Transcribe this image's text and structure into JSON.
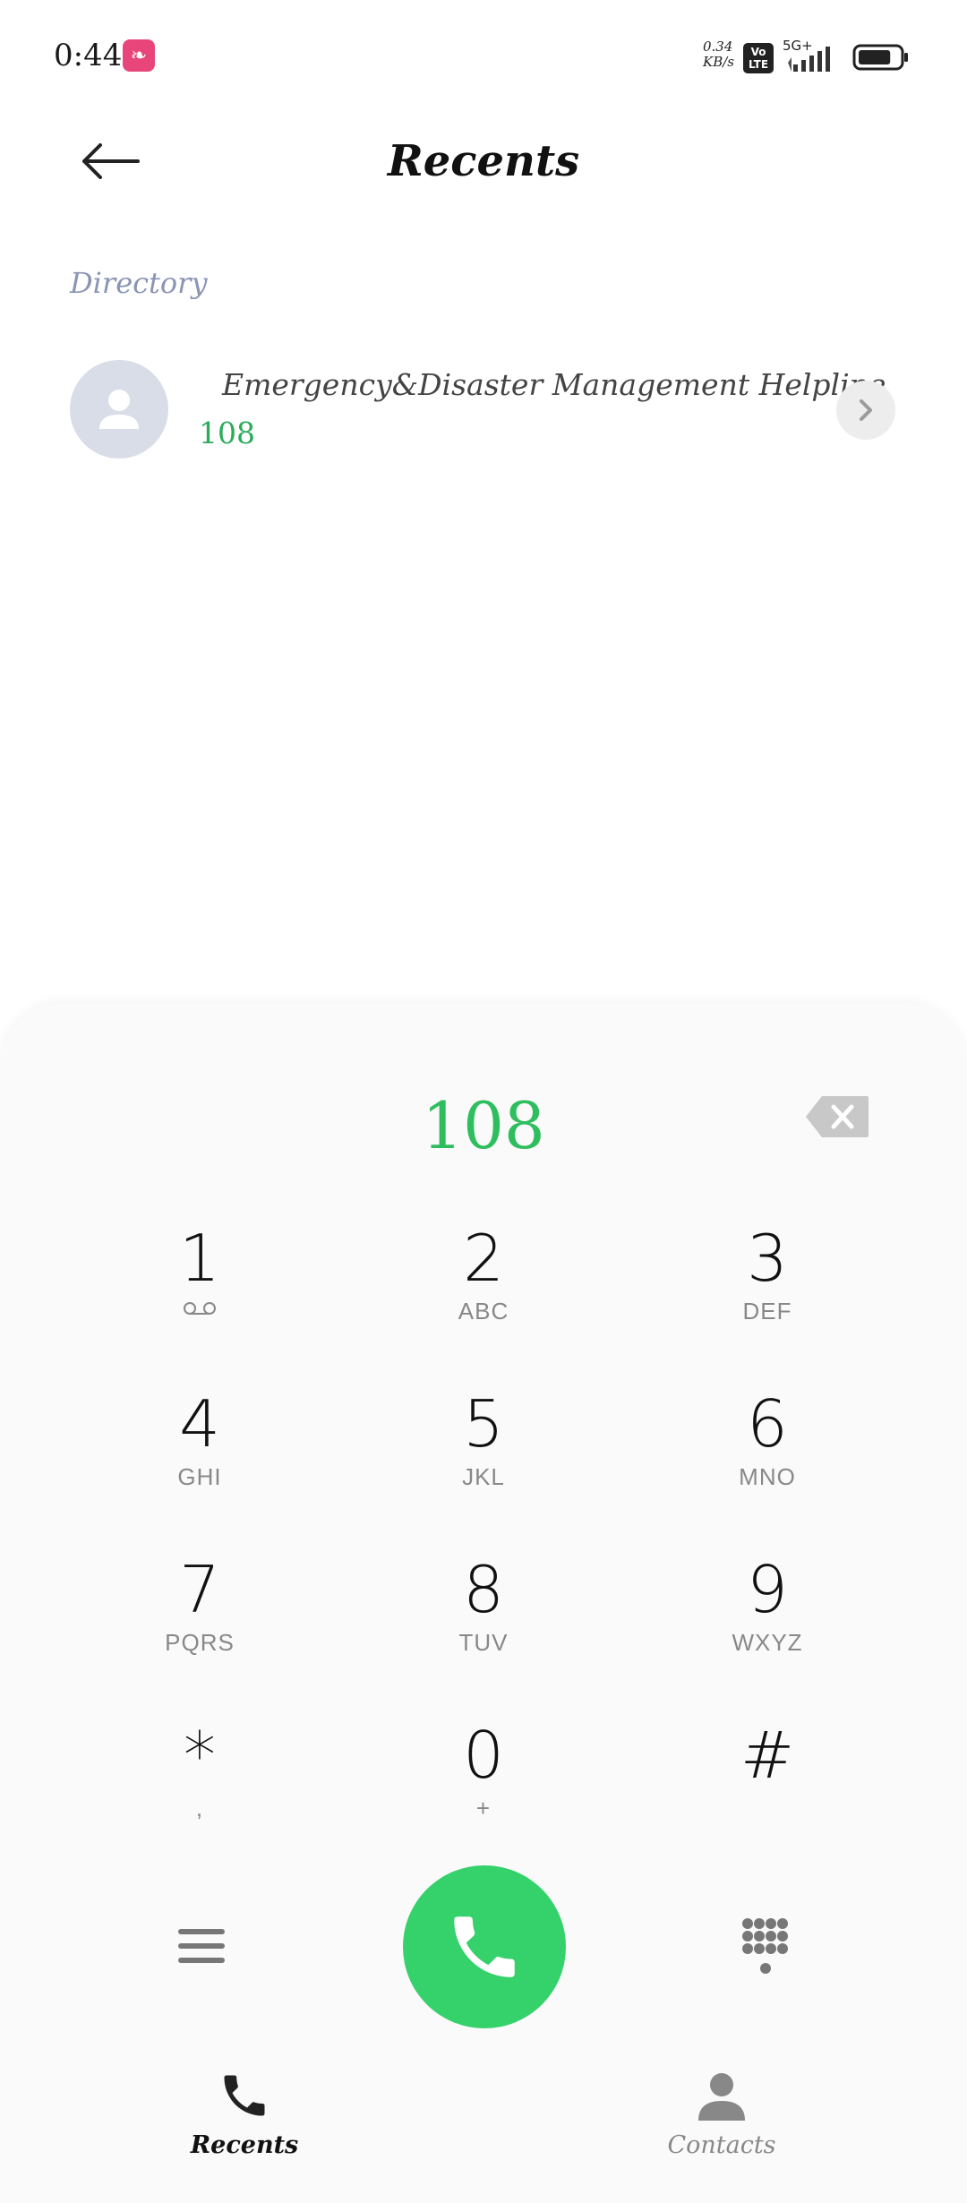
{
  "status_bar": {
    "time": "0:44",
    "net_speed_value": "0.34",
    "net_speed_unit": "KB/s",
    "volte_top": "Vo",
    "volte_bottom": "LTE",
    "network": "5G+",
    "battery_level": 0.8
  },
  "header": {
    "title": "Recents"
  },
  "directory": {
    "label": "Directory",
    "results": [
      {
        "name": "Emergency&Disaster Management Helpline",
        "number": "108"
      }
    ]
  },
  "dialer": {
    "input_value": "108",
    "keys": [
      {
        "digit": "1",
        "letters": ""
      },
      {
        "digit": "2",
        "letters": "ABC"
      },
      {
        "digit": "3",
        "letters": "DEF"
      },
      {
        "digit": "4",
        "letters": "GHI"
      },
      {
        "digit": "5",
        "letters": "JKL"
      },
      {
        "digit": "6",
        "letters": "MNO"
      },
      {
        "digit": "7",
        "letters": "PQRS"
      },
      {
        "digit": "8",
        "letters": "TUV"
      },
      {
        "digit": "9",
        "letters": "WXYZ"
      },
      {
        "digit": "*",
        "letters": ","
      },
      {
        "digit": "0",
        "letters": "+"
      },
      {
        "digit": "#",
        "letters": ""
      }
    ]
  },
  "tabs": [
    {
      "label": "Recents",
      "active": true
    },
    {
      "label": "Contacts",
      "active": false
    }
  ],
  "colors": {
    "accent_green": "#35d16b",
    "number_green": "#2fbe5e",
    "section_label": "#8a94b5"
  }
}
